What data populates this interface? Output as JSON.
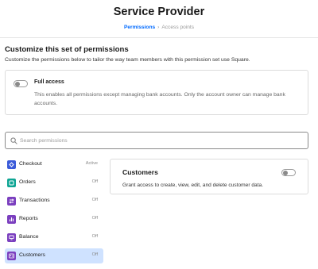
{
  "page": {
    "title": "Service Provider"
  },
  "breadcrumb": {
    "current": "Permissions",
    "separator": "›",
    "next": "Access points"
  },
  "section": {
    "heading": "Customize this set of permissions",
    "description": "Customize the permissions below to tailor the way team members with this permission set use Square."
  },
  "full_access": {
    "label": "Full access",
    "description": "This enables all permissions except managing bank accounts. Only the account owner can manage bank accounts.",
    "enabled": false
  },
  "search": {
    "placeholder": "Search permissions",
    "value": ""
  },
  "permissions": [
    {
      "label": "Checkout",
      "status": "Active",
      "icon": "checkout-icon",
      "color": "#3b5bd9"
    },
    {
      "label": "Orders",
      "status": "Off",
      "icon": "orders-icon",
      "color": "#0fa594"
    },
    {
      "label": "Transactions",
      "status": "Off",
      "icon": "transactions-icon",
      "color": "#7b3fbf"
    },
    {
      "label": "Reports",
      "status": "Off",
      "icon": "reports-icon",
      "color": "#7b3fbf"
    },
    {
      "label": "Balance",
      "status": "Off",
      "icon": "balance-icon",
      "color": "#7b3fbf"
    },
    {
      "label": "Customers",
      "status": "Off",
      "icon": "customers-icon",
      "color": "#7b3fbf",
      "selected": true
    }
  ],
  "detail": {
    "title": "Customers",
    "description": "Grant access to create, view, edit, and delete customer data.",
    "enabled": false
  },
  "colors": {
    "accent": "#006aff",
    "selected_bg": "#cfe2ff"
  }
}
